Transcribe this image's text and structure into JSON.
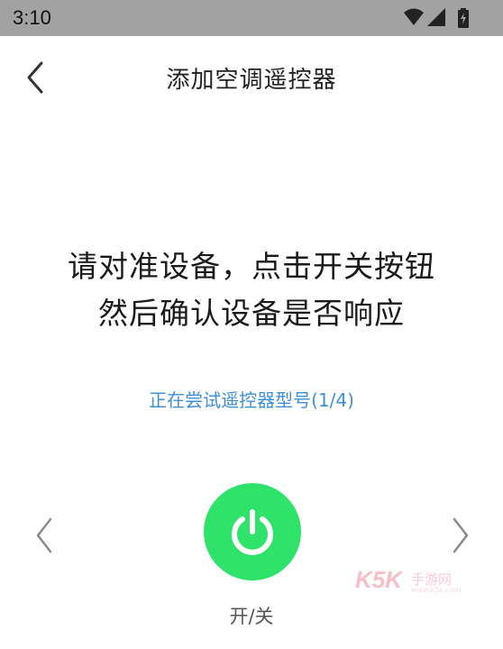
{
  "status_bar": {
    "time": "3:10",
    "icons": [
      "wifi-icon",
      "cellular-signal-icon",
      "battery-icon"
    ]
  },
  "header": {
    "title": "添加空调遥控器",
    "back_icon": "chevron-left-icon"
  },
  "instruction": {
    "line1": "请对准设备，点击开关按钮",
    "line2": "然后确认设备是否响应"
  },
  "model_status": "正在尝试遥控器型号(1/4)",
  "power": {
    "label": "开/关",
    "icon": "power-icon",
    "color": "#2ee26a"
  },
  "navigation": {
    "prev_icon": "chevron-left-icon",
    "next_icon": "chevron-right-icon"
  },
  "watermark": {
    "brand": "K5K",
    "sub": "手游网",
    "url": "www.k5k.com"
  },
  "colors": {
    "accent_blue": "#3f8fd8",
    "status_bar": "#a2a2a2"
  }
}
